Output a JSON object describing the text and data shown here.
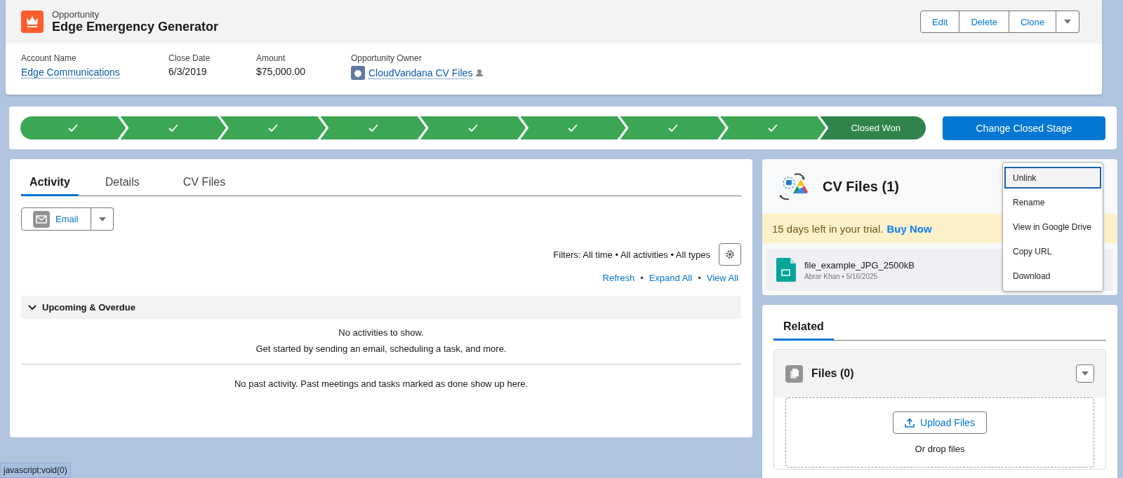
{
  "record": {
    "object_type": "Opportunity",
    "title": "Edge Emergency Generator",
    "actions": [
      "Edit",
      "Delete",
      "Clone"
    ],
    "fields": [
      {
        "label": "Account Name",
        "value": "Edge Communications",
        "kind": "link"
      },
      {
        "label": "Close Date",
        "value": "6/3/2019",
        "kind": "text"
      },
      {
        "label": "Amount",
        "value": "$75,000.00",
        "kind": "text"
      },
      {
        "label": "Opportunity Owner",
        "value": "CloudVandana CV Files",
        "kind": "owner"
      }
    ]
  },
  "path": {
    "stages": [
      {
        "kind": "complete"
      },
      {
        "kind": "complete"
      },
      {
        "kind": "complete"
      },
      {
        "kind": "complete"
      },
      {
        "kind": "complete"
      },
      {
        "kind": "complete"
      },
      {
        "kind": "complete"
      },
      {
        "kind": "complete"
      },
      {
        "kind": "current",
        "label": "Closed Won"
      }
    ],
    "button": "Change Closed Stage"
  },
  "activity": {
    "tabs": [
      {
        "label": "Activity",
        "selected": true
      },
      {
        "label": "Details",
        "selected": false
      },
      {
        "label": "CV Files",
        "selected": false
      }
    ],
    "email_button": "Email",
    "filters": "Filters: All time • All activities • All types",
    "links": [
      "Refresh",
      "Expand All",
      "View All"
    ],
    "link_separator": "•",
    "section": {
      "title": "Upcoming & Overdue",
      "expanded": true,
      "empty_lines": [
        "No activities to show.",
        "Get started by sending an email, scheduling a task, and more."
      ]
    },
    "past": "No past activity. Past meetings and tasks marked as done show up here."
  },
  "cv_files": {
    "title": "CV Files (1)",
    "trial": {
      "text": "15 days left in your trial.",
      "link": "Buy Now"
    },
    "files": [
      {
        "name": "file_example_JPG_2500kB",
        "meta": "Abrar Khan • 5/16/2025"
      }
    ],
    "menu": [
      {
        "label": "Unlink",
        "selected": true
      },
      {
        "label": "Rename",
        "selected": false
      },
      {
        "label": "View in Google Drive",
        "selected": false
      },
      {
        "label": "Copy URL",
        "selected": false
      },
      {
        "label": "Download",
        "selected": false
      }
    ]
  },
  "related": {
    "tabs": [
      {
        "label": "Related",
        "selected": true
      }
    ],
    "files_card": {
      "title": "Files (0)",
      "upload": "Upload Files",
      "drop": "Or drop files"
    }
  },
  "status_bar": "javascript:void(0)"
}
